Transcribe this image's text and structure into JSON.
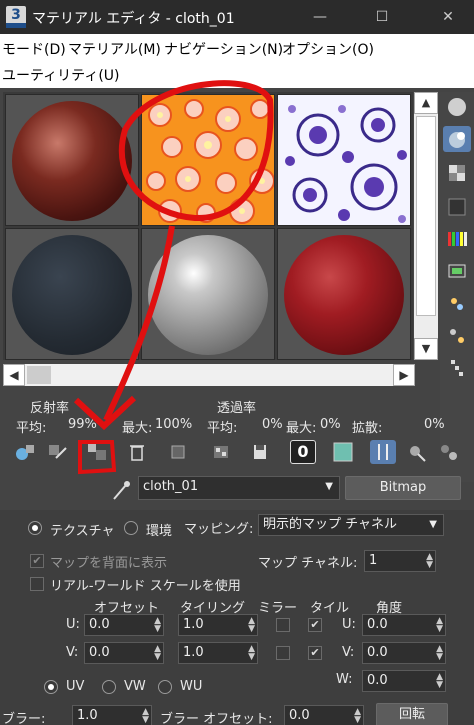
{
  "window": {
    "app_icon": "3",
    "title": "マテリアル エディタ - cloth_01",
    "minimize": "—",
    "maximize": "☐",
    "close": "✕"
  },
  "menu": [
    {
      "label": "モード(D)"
    },
    {
      "label": "マテリアル(M)"
    },
    {
      "label": "ナビゲーション(N)"
    },
    {
      "label": "オプション(O)"
    },
    {
      "label": "ユーティリティ(U)"
    }
  ],
  "stats": {
    "reflect_label": "反射率",
    "transmit_label": "透過率",
    "r_avg_label": "平均:",
    "r_avg": "99%",
    "r_max_label": "最大:",
    "r_max": "100%",
    "t_avg_label": "平均:",
    "t_avg": "0%",
    "t_max_label": "最大:",
    "t_max": "0%",
    "diffuse_label": "拡散:",
    "diffuse": "0%"
  },
  "toolbar": {
    "slot_number": "0"
  },
  "material": {
    "name": "cloth_01",
    "type_button": "Bitmap"
  },
  "coords": {
    "texture_label": "テクスチャ",
    "environ_label": "環境",
    "mapping_label": "マッピング:",
    "mapping_value": "明示的マップ チャネル",
    "show_back_label": "マップを背面に表示",
    "map_channel_label": "マップ チャネル:",
    "map_channel_value": "1",
    "real_world_label": "リアル-ワールド スケールを使用",
    "col_offset": "オフセット",
    "col_tiling": "タイリング",
    "col_mirror": "ミラー",
    "col_tile": "タイル",
    "col_angle": "角度",
    "u_label": "U:",
    "v_label": "V:",
    "w_label": "W:",
    "u_offset": "0.0",
    "u_tiling": "1.0",
    "v_offset": "0.0",
    "v_tiling": "1.0",
    "u_angle": "0.0",
    "v_angle": "0.0",
    "w_angle": "0.0",
    "uv": "UV",
    "vw": "VW",
    "wu": "WU",
    "blur_label": "ブラー:",
    "blur_value": "1.0",
    "blur_offset_label": "ブラー オフセット:",
    "blur_offset_value": "0.0",
    "rotate_button": "回転"
  }
}
